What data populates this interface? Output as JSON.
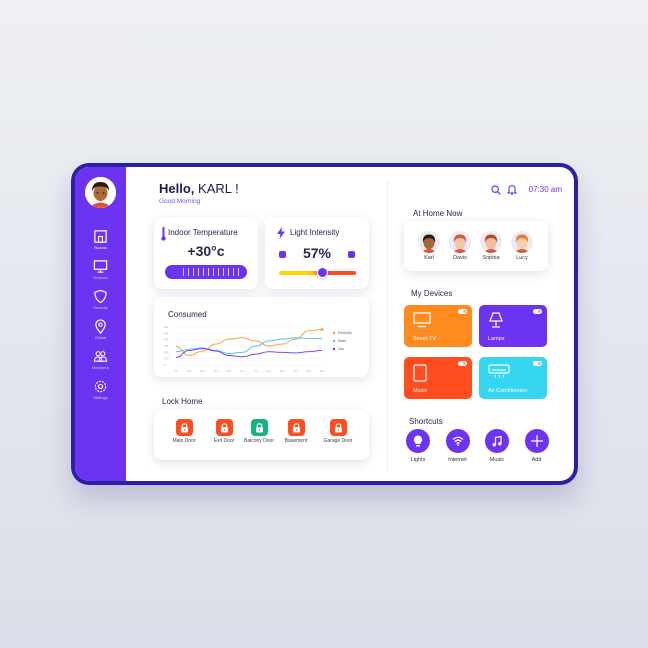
{
  "greeting": {
    "hello": "Hello,",
    "name": " KARL !",
    "subtitle": "Good Morning"
  },
  "sidebar": {
    "items": [
      {
        "label": "Rooms",
        "icon": "home-icon"
      },
      {
        "label": "Devices",
        "icon": "monitor-icon"
      },
      {
        "label": "Security",
        "icon": "shield-icon"
      },
      {
        "label": "Global",
        "icon": "location-pin-icon"
      },
      {
        "label": "Members",
        "icon": "members-icon"
      },
      {
        "label": "Settings",
        "icon": "gear-icon"
      }
    ]
  },
  "temperature": {
    "title": "Indoor Temperature",
    "value": "+30°c"
  },
  "light": {
    "title": "Light Intensity",
    "value": "57%",
    "level": 0.57
  },
  "consumed": {
    "title": "Consumed",
    "chart_data": {
      "type": "line",
      "x": [
        "Jan",
        "Feb",
        "Mar",
        "Apr",
        "May",
        "Jun",
        "Jul",
        "Aug",
        "Sep",
        "Oct",
        "Nov",
        "Dec"
      ],
      "yticks": [
        "600",
        "500",
        "400",
        "300",
        "200",
        "100",
        "0"
      ],
      "ylim": [
        0,
        600
      ],
      "series": [
        {
          "name": "Electricity",
          "color": "#f39a2a",
          "values": [
            290,
            150,
            220,
            330,
            410,
            430,
            380,
            300,
            330,
            410,
            540,
            560
          ]
        },
        {
          "name": "Water",
          "color": "#3fc4e8",
          "values": [
            210,
            250,
            270,
            230,
            180,
            200,
            300,
            380,
            410,
            430,
            420,
            420
          ]
        },
        {
          "name": "Gas",
          "color": "#6c34f0",
          "values": [
            120,
            230,
            260,
            220,
            150,
            130,
            170,
            210,
            200,
            190,
            210,
            230
          ]
        }
      ],
      "legend": "right",
      "grid": true
    }
  },
  "lock": {
    "title": "Lock Home",
    "items": [
      {
        "label": "Main Door",
        "color": "#ff4d1f"
      },
      {
        "label": "Exit Door",
        "color": "#ff4d1f"
      },
      {
        "label": "Balcony Door",
        "color": "#16b285"
      },
      {
        "label": "Basement",
        "color": "#ff4d1f"
      },
      {
        "label": "Garage Door",
        "color": "#ff4d1f"
      }
    ]
  },
  "topbar": {
    "time": "07:30 am"
  },
  "home": {
    "title": "At Home Now",
    "members": [
      {
        "name": "Karl"
      },
      {
        "name": "Davis"
      },
      {
        "name": "Sophia"
      },
      {
        "name": "Lucy"
      }
    ]
  },
  "devices": {
    "title": "My Devices",
    "items": [
      {
        "label": "Smart TV",
        "color": "#ff8a1f",
        "icon": "tv-icon"
      },
      {
        "label": "Lamps",
        "color": "#6c34f0",
        "icon": "lamp-icon"
      },
      {
        "label": "Music",
        "color": "#ff4d1f",
        "icon": "speaker-icon"
      },
      {
        "label": "Air Conditioners",
        "color": "#36d6f2",
        "icon": "air-conditioner-icon"
      }
    ]
  },
  "shortcuts": {
    "title": "Shortcuts",
    "items": [
      {
        "label": "Lights",
        "icon": "bulb-icon"
      },
      {
        "label": "Internet",
        "icon": "wifi-icon"
      },
      {
        "label": "Music",
        "icon": "music-note-icon"
      },
      {
        "label": "Add",
        "icon": "plus-icon"
      }
    ]
  },
  "colors": {
    "accent": "#6c34f0",
    "frame": "#2b1fa3"
  }
}
